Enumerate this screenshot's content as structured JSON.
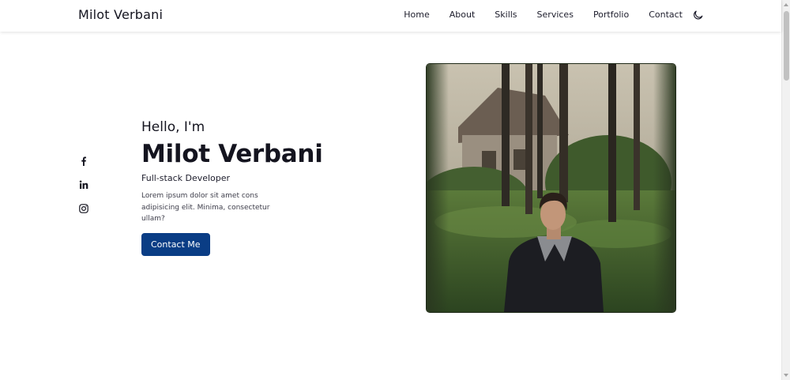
{
  "header": {
    "logo": "Milot Verbani",
    "nav": [
      "Home",
      "About",
      "Skills",
      "Services",
      "Portfolio",
      "Contact"
    ],
    "theme_toggle_icon": "moon-icon"
  },
  "social": [
    {
      "name": "facebook",
      "icon": "facebook-icon"
    },
    {
      "name": "linkedin",
      "icon": "linkedin-icon"
    },
    {
      "name": "instagram",
      "icon": "instagram-icon"
    }
  ],
  "hero": {
    "greeting": "Hello, I'm",
    "name": "Milot Verbani",
    "role": "Full-stack Developer",
    "description": "Lorem ipsum dolor sit amet cons adipisicing elit. Minima, consectetur ullam?",
    "cta_label": "Contact Me"
  },
  "colors": {
    "accent": "#0a3d85",
    "text": "#14141f"
  }
}
